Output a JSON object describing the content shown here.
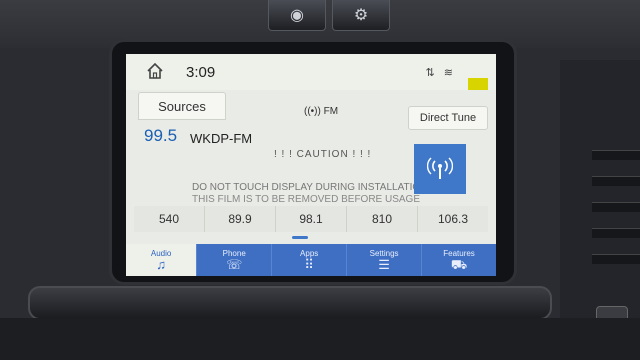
{
  "status": {
    "time": "3:09",
    "icons_text": "⇅ ≋"
  },
  "top_controls": {
    "sources_label": "Sources",
    "band_label": "FM",
    "direct_tune_label": "Direct Tune"
  },
  "now_playing": {
    "frequency": "99.5",
    "station": "WKDP-FM",
    "caution_text": "! ! ! CAUTION ! ! !",
    "film_line_1": "DO NOT TOUCH DISPLAY DURING INSTALLATION",
    "film_line_2": "THIS FILM IS TO BE REMOVED BEFORE USAGE"
  },
  "presets": [
    "540",
    "89.9",
    "98.1",
    "810",
    "106.3"
  ],
  "nav": [
    {
      "label": "Audio",
      "icon": "music-note-icon",
      "glyph": "♫"
    },
    {
      "label": "Phone",
      "icon": "phone-icon",
      "glyph": "☏"
    },
    {
      "label": "Apps",
      "icon": "apps-grid-icon",
      "glyph": "⠿"
    },
    {
      "label": "Settings",
      "icon": "sliders-icon",
      "glyph": "☰"
    },
    {
      "label": "Features",
      "icon": "truck-icon",
      "glyph": "⛟"
    }
  ],
  "colors": {
    "accent": "#3f6fc3",
    "frequency_text": "#1a5fb4",
    "battery_indicator": "#d8d400"
  }
}
